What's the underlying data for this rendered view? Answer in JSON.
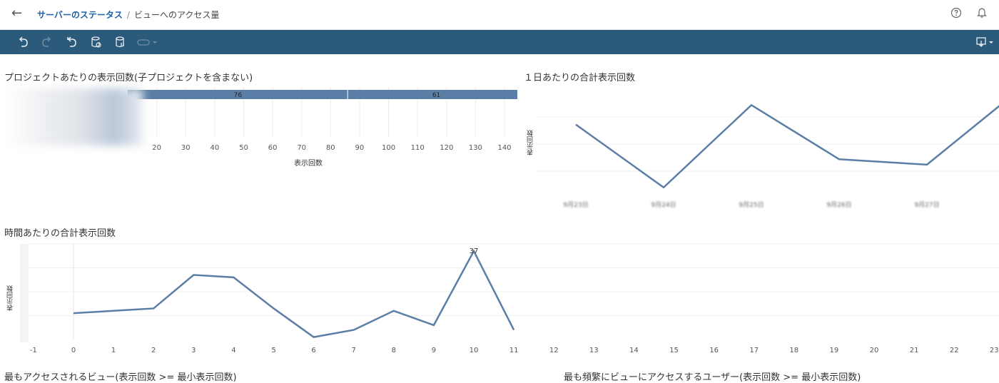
{
  "header": {
    "breadcrumb_parent": "サーバーのステータス",
    "breadcrumb_sep": "/",
    "breadcrumb_current": "ビューへのアクセス量"
  },
  "icons": {
    "back": "arrow-left-icon",
    "help": "help-circle-icon",
    "notifications": "bell-icon",
    "toolbar": [
      "undo-icon",
      "redo-icon",
      "revert-icon",
      "refresh-data-icon",
      "pause-updates-icon",
      "toggle-icon",
      "dropdown-icon",
      "download-icon"
    ]
  },
  "sections": {
    "project_title": "プロジェクトあたりの表示回数(子プロジェクトを含まない)",
    "daily_title": "１日あたりの合計表示回数",
    "hourly_title": "時間あたりの合計表示回数",
    "top_views_title": "最もアクセスされるビュー(表示回数 >= 最小表示回数)",
    "top_users_title": "最も頻繁にビューにアクセスするユーザー(表示回数 >= 最小表示回数)"
  },
  "chart_data": [
    {
      "type": "bar",
      "orientation": "horizontal-stacked",
      "title": "プロジェクトあたりの表示回数(子プロジェクトを含まない)",
      "xlabel": "表示回数",
      "ylabel": "",
      "xticks": [
        20,
        30,
        40,
        50,
        60,
        70,
        80,
        90,
        100,
        110,
        120,
        130,
        140
      ],
      "xlim": [
        10,
        140
      ],
      "segments": [
        76,
        61
      ],
      "color": "#5b7ea6"
    },
    {
      "type": "line",
      "title": "１日あたりの合計表示回数",
      "ylabel": "表示回数",
      "categories": [
        "9月23日",
        "9月24日",
        "9月25日",
        "9月26日",
        "9月27日"
      ],
      "values": [
        0.68,
        0.1,
        0.86,
        0.36,
        0.31
      ],
      "color": "#5b7ea6"
    },
    {
      "type": "line",
      "title": "時間あたりの合計表示回数",
      "ylabel": "表示回数",
      "xticks": [
        -1,
        0,
        1,
        2,
        3,
        4,
        5,
        6,
        7,
        8,
        9,
        10,
        11,
        12,
        13,
        14,
        15,
        16,
        17,
        18,
        19,
        20,
        21,
        22,
        23
      ],
      "x": [
        0,
        1,
        2,
        3,
        4,
        5,
        6,
        7,
        8,
        9,
        10,
        11
      ],
      "values": [
        11,
        12,
        13,
        27,
        26,
        13,
        1,
        4,
        12,
        6,
        37,
        4
      ],
      "peak_label": "37",
      "color": "#5b7ea6"
    }
  ]
}
